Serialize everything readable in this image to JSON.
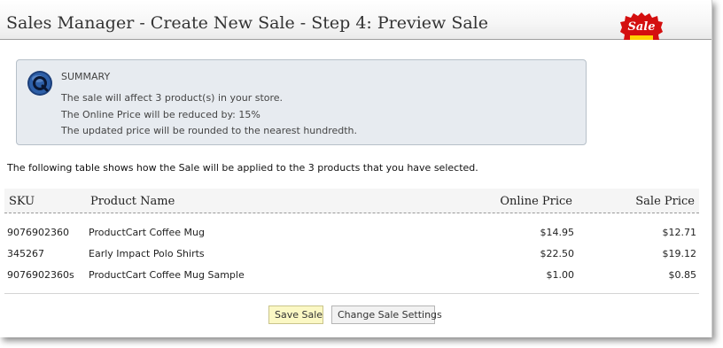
{
  "page": {
    "title": "Sales Manager - Create New Sale - Step 4: Preview Sale",
    "badge_text": "Sale",
    "colors": {
      "badge_red": "#d40f0f",
      "summary_bg": "#e7ebf0",
      "save_button_bg": "#fbf8c4"
    },
    "icons": {
      "info": "info-icon"
    }
  },
  "summary": {
    "heading": "SUMMARY",
    "lines": [
      "The sale will affect 3 product(s) in your store.",
      "The Online Price will be reduced by: 15%",
      "The updated price will be rounded to the nearest hundredth."
    ]
  },
  "intro": "The following table shows how the Sale will be applied to the 3 products that you have selected.",
  "table": {
    "headers": {
      "sku": "SKU",
      "name": "Product Name",
      "online": "Online Price",
      "sale": "Sale Price"
    },
    "rows": [
      {
        "sku": "9076902360",
        "name": "ProductCart Coffee Mug",
        "online": "$14.95",
        "sale": "$12.71"
      },
      {
        "sku": "345267",
        "name": "Early Impact Polo Shirts",
        "online": "$22.50",
        "sale": "$19.12"
      },
      {
        "sku": "9076902360s",
        "name": "ProductCart Coffee Mug Sample",
        "online": "$1.00",
        "sale": "$0.85"
      }
    ]
  },
  "buttons": {
    "save": "Save Sale",
    "change": "Change Sale Settings"
  }
}
